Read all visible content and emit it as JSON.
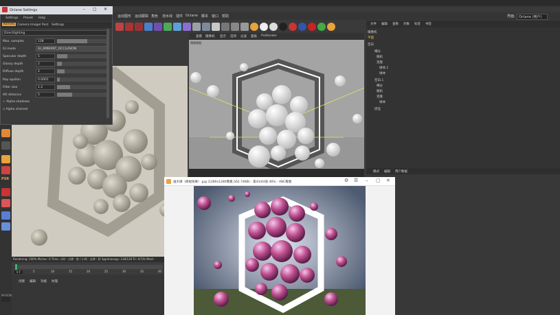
{
  "octane": {
    "title": "Octane Settings",
    "menu": [
      "Settings",
      "Preset",
      "Help"
    ],
    "tabs": [
      "Kernels",
      "Camera Imager",
      "Post",
      "Settings"
    ],
    "kernel_select": "Directlighting",
    "rows": [
      {
        "label": "Max. samples",
        "value": "128",
        "fill": 0.6
      },
      {
        "label": "GI mode",
        "value": "GI_AMBIENT_OCCLUSION",
        "fill": null
      },
      {
        "label": "Specular depth",
        "value": "5",
        "fill": 0.2
      },
      {
        "label": "Glossy depth",
        "value": "2",
        "fill": 0.1
      },
      {
        "label": "Diffuse depth",
        "value": "2",
        "fill": 0.15
      },
      {
        "label": "Ray epsilon",
        "value": "0.0001",
        "fill": 0.05
      },
      {
        "label": "Filter size",
        "value": "1.2",
        "fill": 0.25
      },
      {
        "label": "AO distance",
        "value": "5",
        "fill": 0.3
      }
    ],
    "alpha_shadows": "Alpha shadows",
    "alpha_channel": "Alpha channel"
  },
  "menubar": {
    "items": [
      "运动图形",
      "运动跟踪",
      "角色",
      "流水线",
      "插件",
      "Octane",
      "脚本",
      "窗口",
      "帮助"
    ],
    "layout_label": "界面:",
    "layout_value": "Octane (用户)"
  },
  "viewport_right": {
    "menu": [
      "查看",
      "摄像机",
      "显示",
      "选项",
      "过滤",
      "面板",
      "ProRender"
    ],
    "label": "透视视图"
  },
  "object_manager": {
    "menu": [
      "文件",
      "编辑",
      "查看",
      "对象",
      "标签",
      "书签"
    ],
    "rows": [
      "摄像机",
      "平面",
      "空白",
      "细分",
      "随机",
      "克隆",
      "球体.1",
      "球体",
      "空白.1",
      "细分",
      "随机",
      "克隆",
      "球体",
      "挤压"
    ]
  },
  "attributes": {
    "menu": [
      "模式",
      "编辑",
      "用户数据"
    ]
  },
  "status": {
    "text": "Rendering: 100%   Ms/sec: 0   Time: 小时 : 分钟 : 秒 / 小时 : 分钟 : 秒   Spp/maxspp: 128/128   Tri: 0/72k   Mesh",
    "frames": [
      "0",
      "5",
      "10",
      "15",
      "20",
      "25",
      "30",
      "35",
      "40"
    ],
    "current_frame": "0 F"
  },
  "bottom_menu": [
    "创建",
    "编辑",
    "功能",
    "纹理"
  ],
  "image_viewer": {
    "title": "送大球（俯视效果）.jpg (1280x1280像素,562.74KB) - 第43/44张 46% - ABC看图",
    "accent": "#e8a33d"
  },
  "colors": {
    "accent_orange": "#e8a33d",
    "bg_dark": "#3a3a3a",
    "viewer_titlebar": "#ffffff"
  }
}
